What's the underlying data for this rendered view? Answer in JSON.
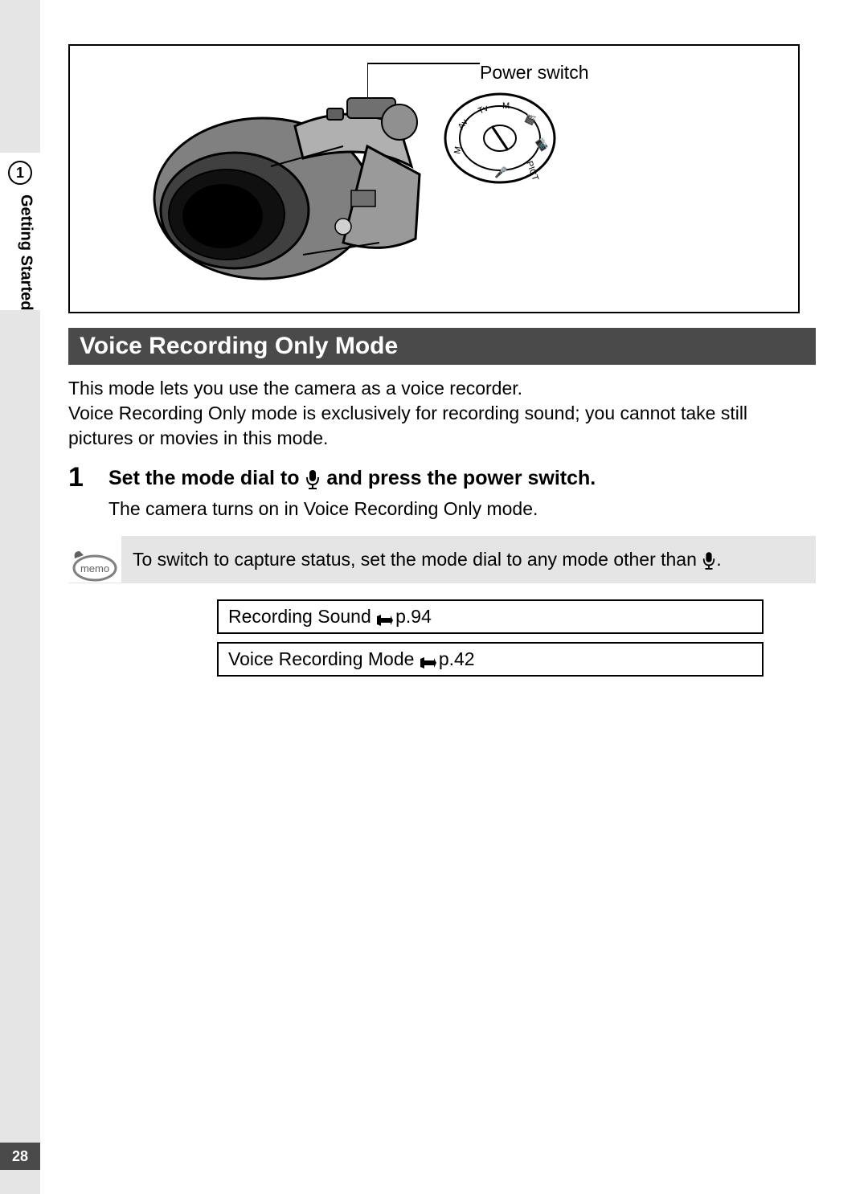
{
  "side": {
    "chapter_number": "1",
    "chapter_title": "Getting Started"
  },
  "illustration": {
    "power_switch_label": "Power switch"
  },
  "section": {
    "heading": "Voice Recording Only Mode",
    "intro": "This mode lets you use the camera as a voice recorder.\nVoice Recording Only mode is exclusively for recording sound; you cannot take still pictures or movies in this mode."
  },
  "step": {
    "number": "1",
    "instruction_before_icon": "Set the mode dial to ",
    "instruction_after_icon": " and press the power switch.",
    "result": "The camera turns on in Voice Recording Only mode."
  },
  "memo": {
    "label": "memo",
    "text_before_icon": "To switch to capture status, set the mode dial to any mode other than ",
    "text_after_icon": "."
  },
  "refs": [
    {
      "label": "Recording Sound ",
      "page": "p.94"
    },
    {
      "label": "Voice Recording Mode ",
      "page": "p.42"
    }
  ],
  "page_number": "28"
}
